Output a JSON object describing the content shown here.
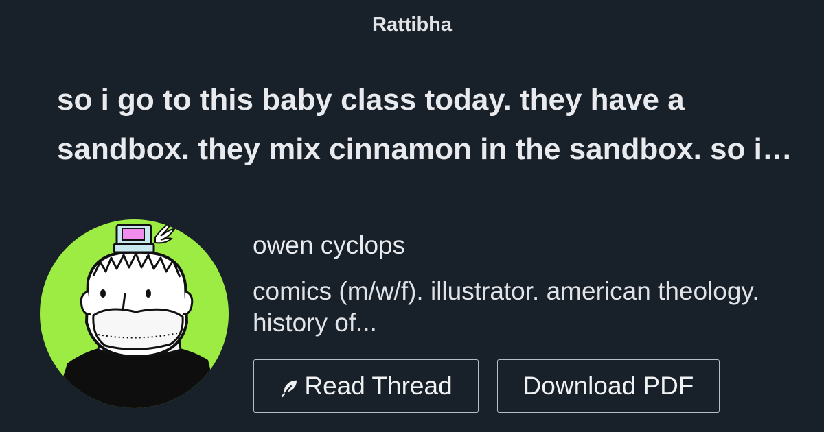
{
  "site": {
    "name": "Rattibha"
  },
  "thread": {
    "title": "so i go to this baby class today. they have a sandbox. they mix cinnamon in the sandbox. so it smells like cinnamon"
  },
  "author": {
    "name": "owen cyclops",
    "bio": "comics (m/w/f). illustrator. american theology. history of..."
  },
  "actions": {
    "read_label": "Read Thread",
    "read_icon": "feather-icon",
    "pdf_label": "Download PDF"
  },
  "colors": {
    "background": "#18202a",
    "avatar_background": "#9cec44",
    "text": "#e6e8ec",
    "button_border": "#b9bec6"
  }
}
